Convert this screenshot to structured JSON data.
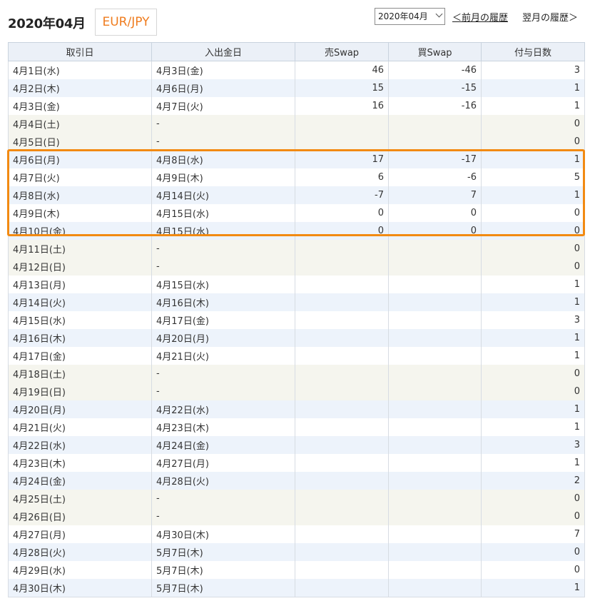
{
  "header": {
    "title": "2020年04月",
    "pair": "EUR/JPY",
    "month_select": "2020年04月",
    "prev_link": "＜前月の履歴",
    "next_link": "翌月の履歴＞"
  },
  "table": {
    "columns": [
      "取引日",
      "入出金日",
      "売Swap",
      "買Swap",
      "付与日数"
    ],
    "rows": [
      {
        "trade": "4月1日(水)",
        "settle": "4月3日(金)",
        "sell": "46",
        "buy": "-46",
        "days": "3",
        "style": "white"
      },
      {
        "trade": "4月2日(木)",
        "settle": "4月6日(月)",
        "sell": "15",
        "buy": "-15",
        "days": "1",
        "style": "blue"
      },
      {
        "trade": "4月3日(金)",
        "settle": "4月7日(火)",
        "sell": "16",
        "buy": "-16",
        "days": "1",
        "style": "white"
      },
      {
        "trade": "4月4日(土)",
        "settle": "-",
        "sell": "",
        "buy": "",
        "days": "0",
        "style": "weekend"
      },
      {
        "trade": "4月5日(日)",
        "settle": "-",
        "sell": "",
        "buy": "",
        "days": "0",
        "style": "weekend"
      },
      {
        "trade": "4月6日(月)",
        "settle": "4月8日(水)",
        "sell": "17",
        "buy": "-17",
        "days": "1",
        "style": "blue"
      },
      {
        "trade": "4月7日(火)",
        "settle": "4月9日(木)",
        "sell": "6",
        "buy": "-6",
        "days": "5",
        "style": "white"
      },
      {
        "trade": "4月8日(水)",
        "settle": "4月14日(火)",
        "sell": "-7",
        "buy": "7",
        "days": "1",
        "style": "blue"
      },
      {
        "trade": "4月9日(木)",
        "settle": "4月15日(水)",
        "sell": "0",
        "buy": "0",
        "days": "0",
        "style": "white"
      },
      {
        "trade": "4月10日(金)",
        "settle": "4月15日(水)",
        "sell": "0",
        "buy": "0",
        "days": "0",
        "style": "blue"
      },
      {
        "trade": "4月11日(土)",
        "settle": "-",
        "sell": "",
        "buy": "",
        "days": "0",
        "style": "weekend"
      },
      {
        "trade": "4月12日(日)",
        "settle": "-",
        "sell": "",
        "buy": "",
        "days": "0",
        "style": "weekend"
      },
      {
        "trade": "4月13日(月)",
        "settle": "4月15日(水)",
        "sell": "",
        "buy": "",
        "days": "1",
        "style": "white"
      },
      {
        "trade": "4月14日(火)",
        "settle": "4月16日(木)",
        "sell": "",
        "buy": "",
        "days": "1",
        "style": "blue"
      },
      {
        "trade": "4月15日(水)",
        "settle": "4月17日(金)",
        "sell": "",
        "buy": "",
        "days": "3",
        "style": "white"
      },
      {
        "trade": "4月16日(木)",
        "settle": "4月20日(月)",
        "sell": "",
        "buy": "",
        "days": "1",
        "style": "blue"
      },
      {
        "trade": "4月17日(金)",
        "settle": "4月21日(火)",
        "sell": "",
        "buy": "",
        "days": "1",
        "style": "white"
      },
      {
        "trade": "4月18日(土)",
        "settle": "-",
        "sell": "",
        "buy": "",
        "days": "0",
        "style": "weekend"
      },
      {
        "trade": "4月19日(日)",
        "settle": "-",
        "sell": "",
        "buy": "",
        "days": "0",
        "style": "weekend"
      },
      {
        "trade": "4月20日(月)",
        "settle": "4月22日(水)",
        "sell": "",
        "buy": "",
        "days": "1",
        "style": "blue"
      },
      {
        "trade": "4月21日(火)",
        "settle": "4月23日(木)",
        "sell": "",
        "buy": "",
        "days": "1",
        "style": "white"
      },
      {
        "trade": "4月22日(水)",
        "settle": "4月24日(金)",
        "sell": "",
        "buy": "",
        "days": "3",
        "style": "blue"
      },
      {
        "trade": "4月23日(木)",
        "settle": "4月27日(月)",
        "sell": "",
        "buy": "",
        "days": "1",
        "style": "white"
      },
      {
        "trade": "4月24日(金)",
        "settle": "4月28日(火)",
        "sell": "",
        "buy": "",
        "days": "2",
        "style": "blue"
      },
      {
        "trade": "4月25日(土)",
        "settle": "-",
        "sell": "",
        "buy": "",
        "days": "0",
        "style": "weekend"
      },
      {
        "trade": "4月26日(日)",
        "settle": "-",
        "sell": "",
        "buy": "",
        "days": "0",
        "style": "weekend"
      },
      {
        "trade": "4月27日(月)",
        "settle": "4月30日(木)",
        "sell": "",
        "buy": "",
        "days": "7",
        "style": "white"
      },
      {
        "trade": "4月28日(火)",
        "settle": "5月7日(木)",
        "sell": "",
        "buy": "",
        "days": "0",
        "style": "blue"
      },
      {
        "trade": "4月29日(水)",
        "settle": "5月7日(木)",
        "sell": "",
        "buy": "",
        "days": "0",
        "style": "white"
      },
      {
        "trade": "4月30日(木)",
        "settle": "5月7日(木)",
        "sell": "",
        "buy": "",
        "days": "1",
        "style": "blue"
      }
    ]
  },
  "colors": {
    "accent_pair": "#ef7c1e",
    "highlight_border": "#f28a12",
    "header_bg": "#ebf0f7",
    "row_blue": "#edf3fb",
    "row_weekend": "#f5f5ee"
  }
}
